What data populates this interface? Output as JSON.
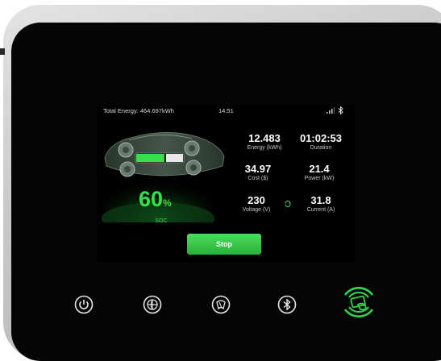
{
  "status_bar": {
    "total_energy": "Total Energy: 464.697kWh",
    "time": "14:51"
  },
  "soc": {
    "value": "60",
    "unit": "%",
    "label": "SOC",
    "level_fraction": 0.6
  },
  "metrics": [
    {
      "value": "12.483",
      "label": "Energy (kWh)"
    },
    {
      "value": "01:02:53",
      "label": "Duration"
    },
    {
      "value": "34.97",
      "label": "Cost ($)"
    },
    {
      "value": "21.4",
      "label": "Power (kW)"
    },
    {
      "value": "230",
      "label": "Voltage (V)"
    },
    {
      "value": "31.8",
      "label": "Current (A)"
    }
  ],
  "stop_button": {
    "label": "Stop"
  },
  "colors": {
    "accent_green": "#35e04a",
    "button_green": "#2fc544",
    "background": "#000000"
  },
  "hardware_buttons": [
    "power-icon",
    "globe-icon",
    "language-icon",
    "bluetooth-icon",
    "rfid-card-icon"
  ]
}
